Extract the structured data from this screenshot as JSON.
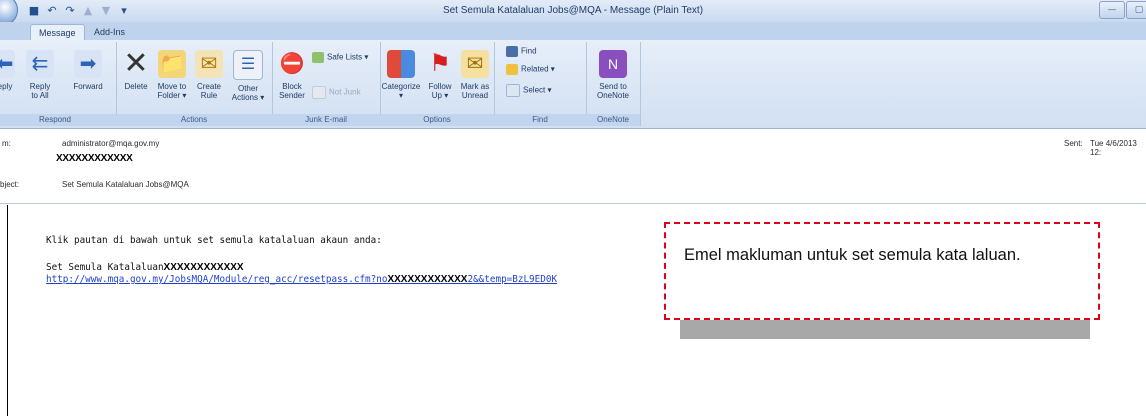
{
  "window": {
    "title": "Set Semula Katalaluan Jobs@MQA - Message (Plain Text)",
    "quick_access": [
      "save-icon",
      "undo-icon",
      "redo-icon",
      "up-icon",
      "down-icon",
      "dropdown-icon"
    ]
  },
  "tabs": {
    "message": "Message",
    "addins": "Add-Ins"
  },
  "ribbon": {
    "respond": {
      "label": "Respond",
      "reply": "eply",
      "reply_all_1": "Reply",
      "reply_all_2": "to All",
      "forward": "Forward"
    },
    "actions": {
      "label": "Actions",
      "delete": "Delete",
      "move_1": "Move to",
      "move_2": "Folder ▾",
      "create_1": "Create",
      "create_2": "Rule",
      "other_1": "Other",
      "other_2": "Actions ▾"
    },
    "junk": {
      "label": "Junk E-mail",
      "block_1": "Block",
      "block_2": "Sender",
      "safe_lists": "Safe Lists ▾",
      "not_junk": "Not Junk"
    },
    "options": {
      "label": "Options",
      "categorize": "Categorize",
      "follow_1": "Follow",
      "follow_2": "Up ▾",
      "mark_1": "Mark as",
      "mark_2": "Unread"
    },
    "find": {
      "label": "Find",
      "find": "Find",
      "related": "Related ▾",
      "select": "Select ▾"
    },
    "onenote": {
      "label": "OneNote",
      "send_1": "Send to",
      "send_2": "OneNote"
    }
  },
  "header": {
    "from_label": "m:",
    "from_value": "administrator@mqa.gov.my",
    "to_redacted": "XXXXXXXXXXXX",
    "sent_label": "Sent:",
    "sent_value": "Tue 4/6/2013 12:",
    "subject_label": "bject:",
    "subject_value": "Set Semula Katalaluan Jobs@MQA"
  },
  "message": {
    "line1": "Klik pautan di bawah untuk set semula katalaluan akaun anda:",
    "line2_prefix": "Set Semula Katalaluan",
    "line2_redacted": "XXXXXXXXXXXX",
    "link_part1": "http://www.mqa.gov.my/JobsMQA/Module/reg_acc/resetpass.cfm?no",
    "link_redacted": "XXXXXXXXXXXX",
    "link_part2": "2&&temp=BzL9ED0K"
  },
  "callout": {
    "text": "Emel makluman untuk set semula kata laluan."
  },
  "colors": {
    "callout_border": "#e0001a",
    "link": "#1f3fcf",
    "ribbon_bg": "#dbe6f5"
  }
}
